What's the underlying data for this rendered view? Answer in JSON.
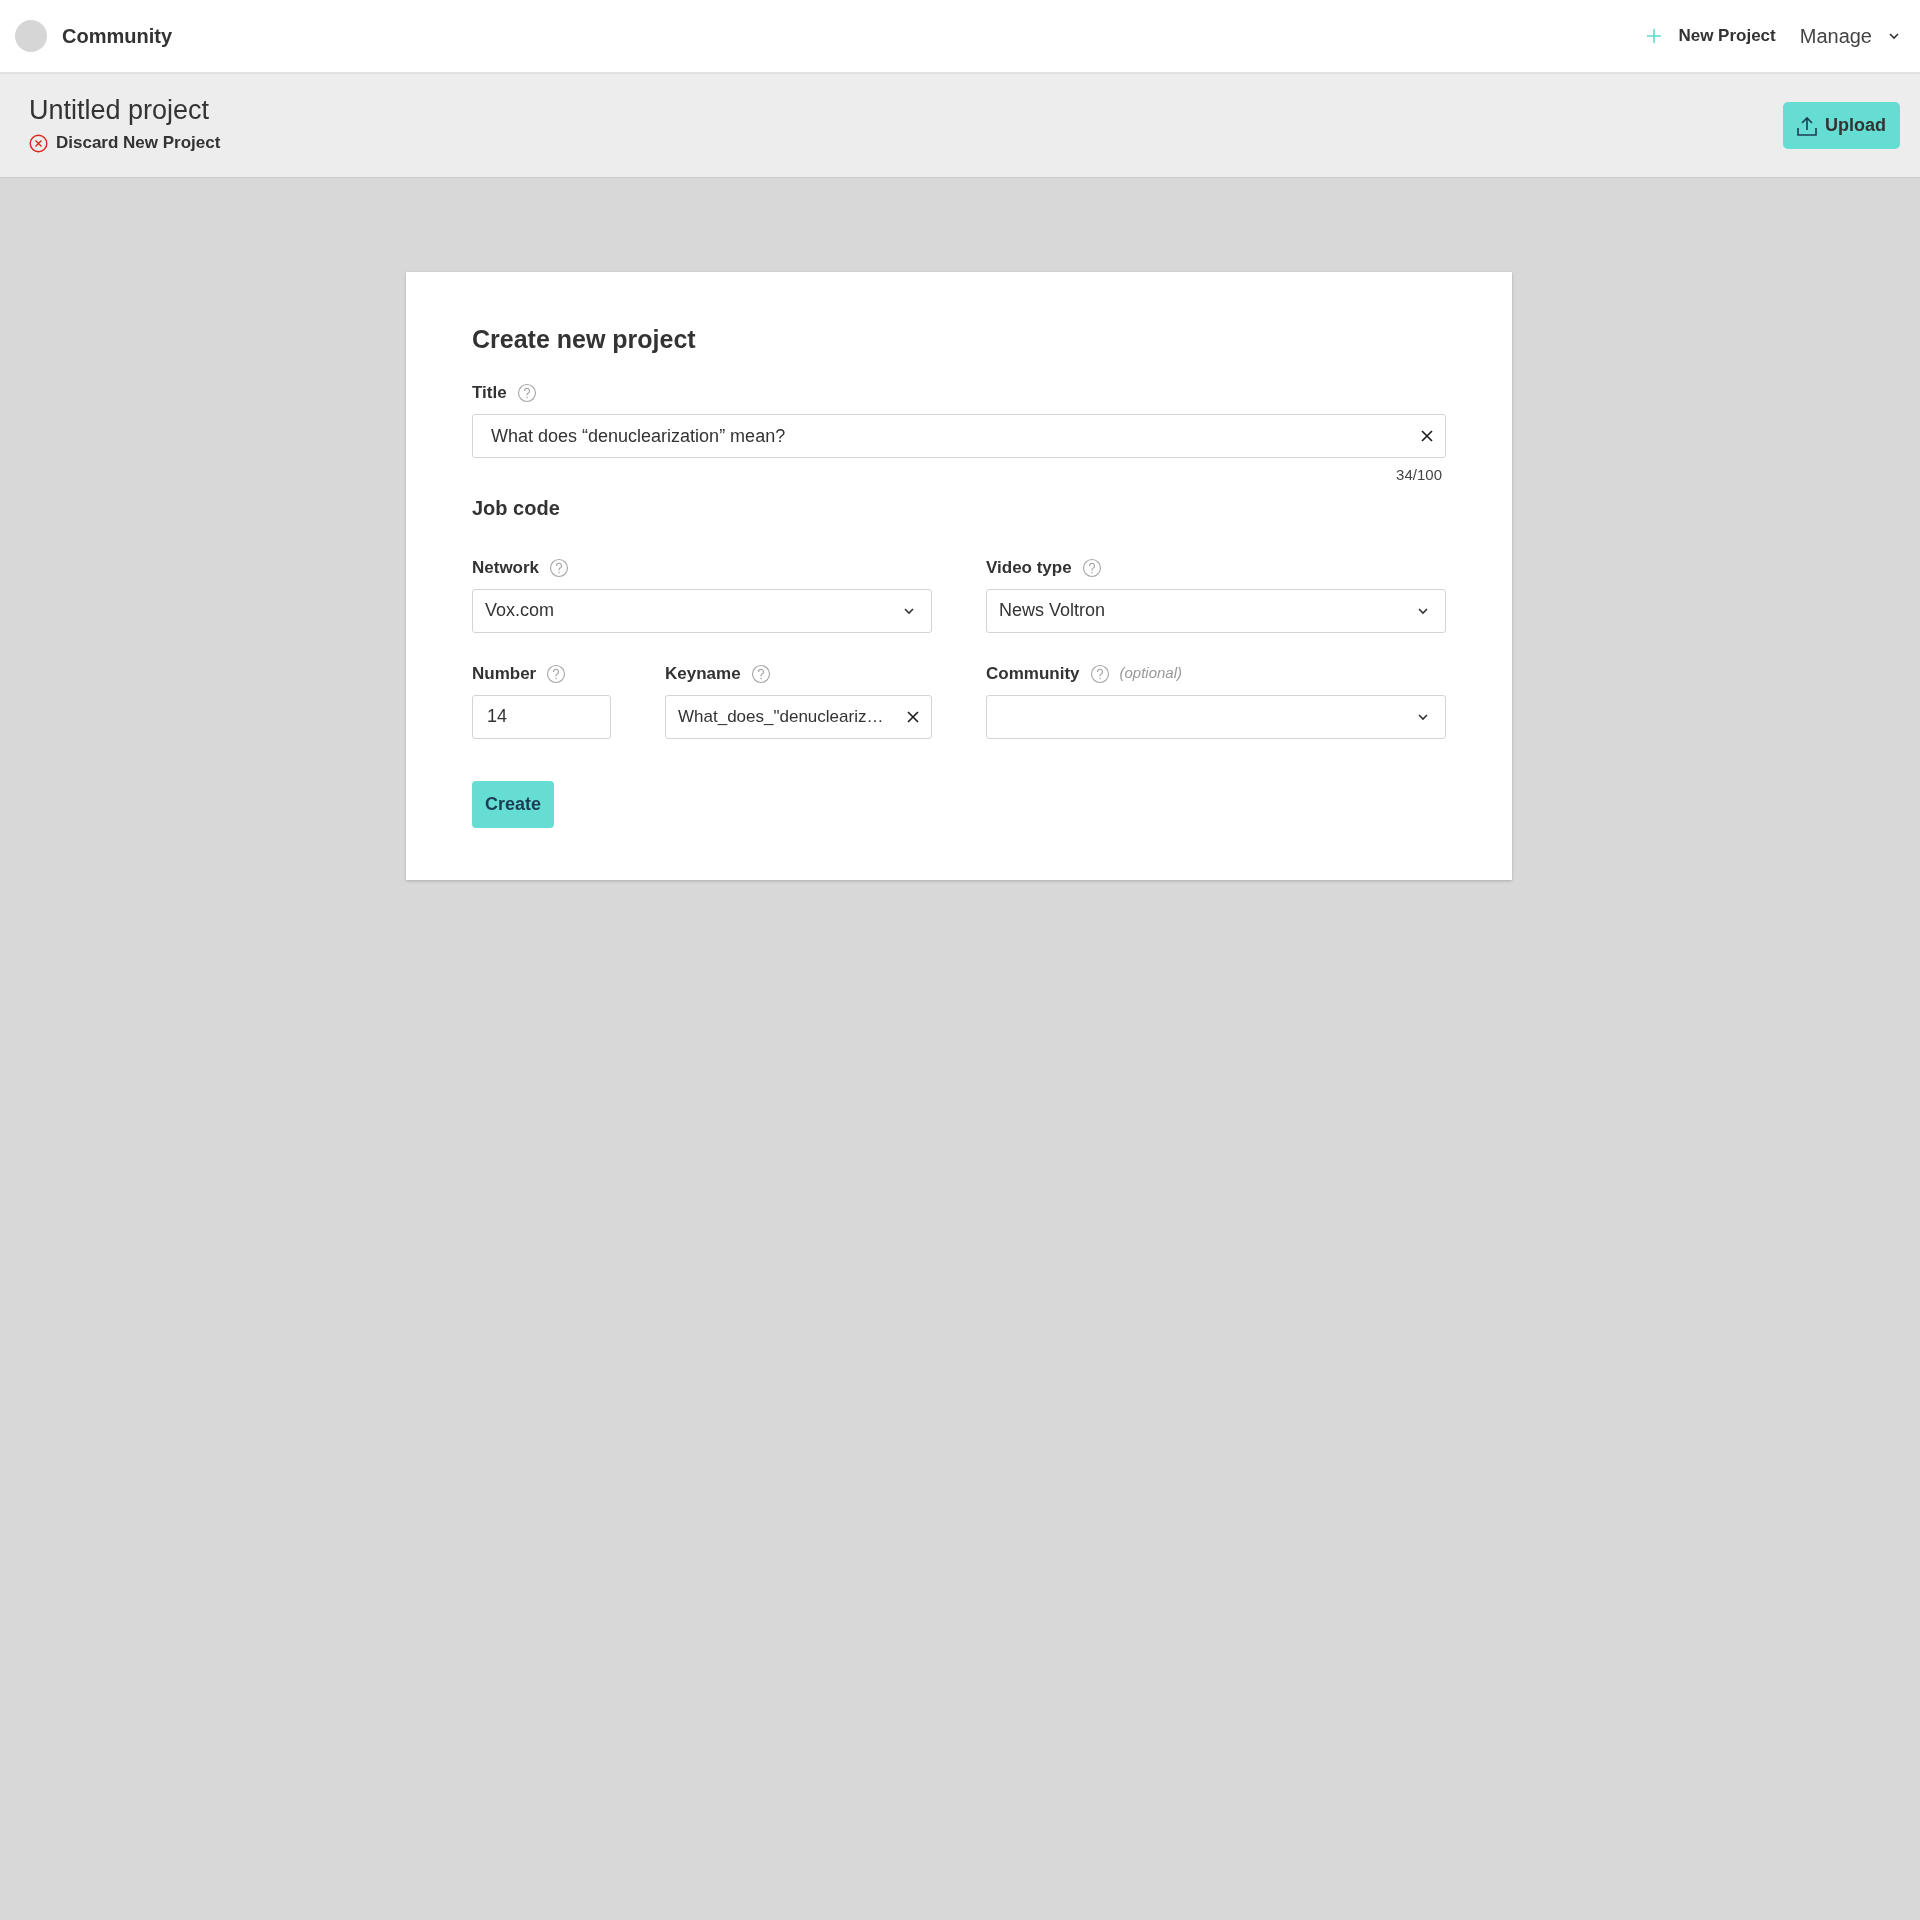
{
  "topbar": {
    "brand": "Community",
    "actions": [
      {
        "kind": "new",
        "label": "New Project"
      },
      {
        "kind": "menu",
        "label": "Manage"
      }
    ]
  },
  "header": {
    "title": "Untitled project",
    "discard": "Discard New Project",
    "upload": "Upload"
  },
  "form": {
    "heading": "Create new project",
    "title_field": {
      "label": "Title",
      "value": "What does “denuclearization” mean?",
      "counter": "34/100"
    },
    "section": "Job code",
    "fields": [
      {
        "kind": "select",
        "label": "Network",
        "value": "Vox.com"
      },
      {
        "kind": "select",
        "label": "Video type",
        "value": "News Voltron"
      },
      {
        "kind": "input",
        "label": "Number",
        "value": "14"
      },
      {
        "kind": "clearable",
        "label": "Keyname",
        "value": "What_does_\"denucleariz…"
      },
      {
        "kind": "select",
        "label": "Community",
        "note": "(optional)"
      }
    ],
    "submit": "Create"
  }
}
